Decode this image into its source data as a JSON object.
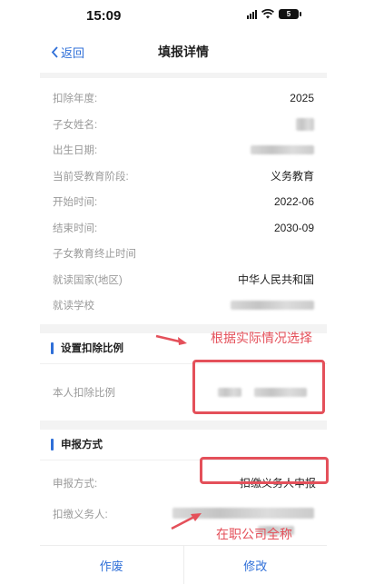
{
  "status_bar": {
    "time": "15:09",
    "battery": "5"
  },
  "nav": {
    "back_label": "返回",
    "title": "填报详情"
  },
  "details": [
    {
      "label": "扣除年度:",
      "value": "2025",
      "redacted": false
    },
    {
      "label": "子女姓名:",
      "value": "",
      "redacted": true
    },
    {
      "label": "出生日期:",
      "value": "",
      "redacted": true
    },
    {
      "label": "当前受教育阶段:",
      "value": "义务教育",
      "redacted": false
    },
    {
      "label": "开始时间:",
      "value": "2022-06",
      "redacted": false
    },
    {
      "label": "结束时间:",
      "value": "2030-09",
      "redacted": false
    },
    {
      "label": "子女教育终止时间",
      "value": "",
      "redacted": false
    },
    {
      "label": "就读国家(地区)",
      "value": "中华人民共和国",
      "redacted": false
    },
    {
      "label": "就读学校",
      "value": "",
      "redacted": true
    }
  ],
  "ratio_section": {
    "title": "设置扣除比例",
    "row_label": "本人扣除比例"
  },
  "method_section": {
    "title": "申报方式",
    "method_label": "申报方式:",
    "method_value": "扣缴义务人申报",
    "agent_label": "扣缴义务人:"
  },
  "annotations": {
    "choose_text": "根据实际情况选择",
    "company_text": "在职公司全称",
    "color": "#e4505a"
  },
  "bottom_bar": {
    "void_label": "作废",
    "modify_label": "修改"
  },
  "colors": {
    "accent": "#2f6fd8",
    "label": "#9a9a9a",
    "section_gap": "#f3f3f3"
  }
}
